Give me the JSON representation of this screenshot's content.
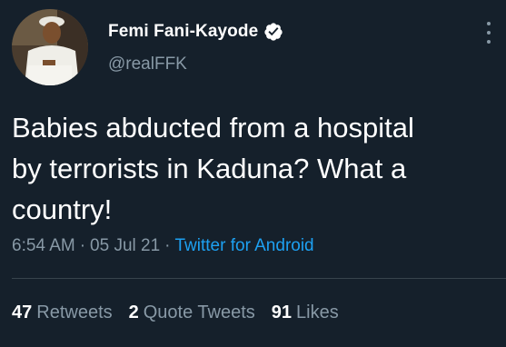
{
  "author": {
    "display_name": "Femi Fani-Kayode",
    "handle": "@realFFK",
    "verified": true,
    "verified_icon": "verified-badge-icon"
  },
  "tweet": {
    "text": "Babies abducted from a hospital\nby terrorists in Kaduna? What a\ncountry!",
    "time": "6:54 AM",
    "date": "05 Jul 21",
    "separator": "·",
    "source": "Twitter for Android"
  },
  "stats": {
    "retweets_count": "47",
    "retweets_label": "Retweets",
    "quotes_count": "2",
    "quotes_label": "Quote Tweets",
    "likes_count": "91",
    "likes_label": "Likes"
  },
  "colors": {
    "background": "#15202b",
    "text_primary": "#ffffff",
    "text_secondary": "#8899a6",
    "accent": "#1da1f2",
    "divider": "#38444d"
  }
}
